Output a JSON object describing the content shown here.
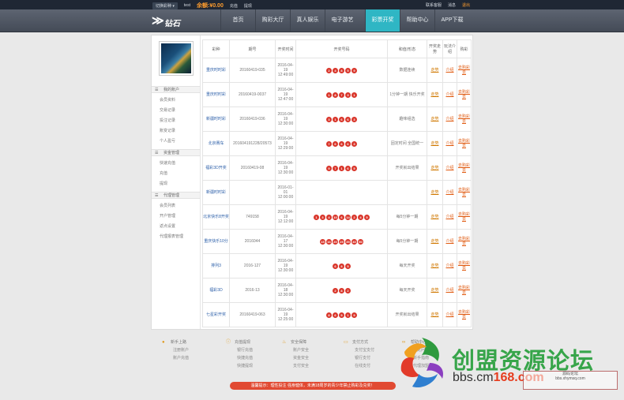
{
  "topbar": {
    "switch": "切换彩种",
    "user": "test",
    "balance_label": "余额:",
    "balance_value": "¥0.00",
    "deposit": "充值",
    "withdraw": "提现",
    "right_items": [
      "联系客服",
      "消息",
      "退出"
    ]
  },
  "logo": "钻石",
  "nav": [
    {
      "label": "首页"
    },
    {
      "label": "购彩大厅"
    },
    {
      "label": "真人娱乐"
    },
    {
      "label": "电子游艺"
    },
    {
      "label": "彩票开奖"
    },
    {
      "label": "帮助中心"
    },
    {
      "label": "APP下载"
    }
  ],
  "side": {
    "sections": [
      {
        "title": "我的账户",
        "items": [
          "会员资料",
          "交易记录",
          "投注记录",
          "账变记录",
          "个人盈亏"
        ]
      },
      {
        "title": "资金管理",
        "items": [
          "快速充值",
          "充值",
          "提现"
        ]
      },
      {
        "title": "代理管理",
        "items": [
          "会员列表",
          "开户管理",
          "返点设置",
          "代理报表管理"
        ]
      }
    ]
  },
  "table": {
    "headers": [
      "彩种",
      "期号",
      "开奖时间",
      "开奖号码",
      "和值/形态",
      "开奖走势",
      "玩法介绍",
      "购彩"
    ],
    "rows": [
      {
        "name": "重庆时时彩",
        "issue": "20160419-035",
        "time": "2016-04-19 12:49:00",
        "balls": [
          "2",
          "4",
          "8",
          "5",
          "9"
        ],
        "extra": "数据连续",
        "k": "走势",
        "c": "介绍",
        "b": "去购彩去"
      },
      {
        "name": "重庆时时彩",
        "issue": "20160419-0037",
        "time": "2016-04-19 12:47:00",
        "balls": [
          "1",
          "8",
          "7",
          "3",
          "1"
        ],
        "extra": "1分钟一期 快乐开奖",
        "k": "走势",
        "c": "介绍",
        "b": "去购彩去"
      },
      {
        "name": "新疆时时彩",
        "issue": "20160419-036",
        "time": "2016-04-19 12:30:00",
        "balls": [
          "3",
          "1",
          "6",
          "6",
          "3"
        ],
        "extra": "趣味组选",
        "k": "走势",
        "c": "介绍",
        "b": "去购彩去"
      },
      {
        "name": "北京赛车",
        "issue": "201604191228/20573",
        "time": "2016-04-19 12:29:00",
        "balls": [
          "7",
          "6",
          "6",
          "6",
          "3"
        ],
        "extra": "固定时间 全国统一",
        "k": "走势",
        "c": "介绍",
        "b": "去购彩去"
      },
      {
        "name": "福彩3D开奖",
        "issue": "20160419-08",
        "time": "2016-04-19 12:30:00",
        "balls": [
          "9",
          "7",
          "1",
          "6",
          "5"
        ],
        "extra": "开奖就出结果",
        "k": "走势",
        "c": "介绍",
        "b": "去购彩去"
      },
      {
        "name": "新疆时时彩",
        "issue": "",
        "time": "2016-01-01 12:00:00",
        "balls": [],
        "extra": "",
        "k": "走势",
        "c": "介绍",
        "b": "去购彩去"
      },
      {
        "name": "北京快乐8开奖",
        "issue": "749158",
        "time": "2016-04-19 12:12:00",
        "balls": [
          "1",
          "3",
          "4",
          "10",
          "6",
          "14",
          "2",
          "4",
          "5"
        ],
        "extra": "每5分钟一期",
        "k": "走势",
        "c": "介绍",
        "b": "去购彩去"
      },
      {
        "name": "重庆快乐10分",
        "issue": "2016044",
        "time": "2016-04-17 12:30:00",
        "balls": [
          "15",
          "16",
          "20",
          "25",
          "35",
          "40",
          "50"
        ],
        "extra": "每5分钟一期",
        "k": "走势",
        "c": "介绍",
        "b": "去购彩去"
      },
      {
        "name": "排列3",
        "issue": "2016-127",
        "time": "2016-04-19 12:30:00",
        "balls": [
          "6",
          "8",
          "5"
        ],
        "extra": "每天开奖",
        "k": "走势",
        "c": "介绍",
        "b": "去购彩去"
      },
      {
        "name": "福彩3D",
        "issue": "2016-13",
        "time": "2016-04-18 12:30:00",
        "balls": [
          "2",
          "8",
          "2"
        ],
        "extra": "每天开奖",
        "k": "走势",
        "c": "介绍",
        "b": "去购彩去"
      },
      {
        "name": "七星彩开奖",
        "issue": "20160419-063",
        "time": "2016-04-19 12:25:00",
        "balls": [
          "8",
          "6",
          "5",
          "1",
          "9"
        ],
        "extra": "开奖就出结果",
        "k": "走势",
        "c": "介绍",
        "b": "去购彩去"
      }
    ]
  },
  "footer": [
    {
      "title": "新手上路",
      "icon": "user-icon",
      "links": [
        "注册账户",
        "账户充值"
      ]
    },
    {
      "title": "充值提现",
      "icon": "info-icon",
      "links": [
        "银行充值",
        "快捷充值",
        "快捷提现"
      ]
    },
    {
      "title": "安全保障",
      "icon": "fire-icon",
      "links": [
        "账户安全",
        "资金安全",
        "支付安全"
      ]
    },
    {
      "title": "支付方式",
      "icon": "card-icon",
      "links": [
        "支付宝支付",
        "银行支付",
        "在线支付"
      ]
    },
    {
      "title": "帮助中心",
      "icon": "link-icon",
      "links": [
        "常见问题",
        "新手指南",
        "代理加盟"
      ]
    }
  ],
  "redbar": "温馨提示：理性投注 强身健体，未满18周岁的青少年禁止购彩及兑奖！",
  "watermark": {
    "title": "创盟资源论坛",
    "url_a": "bbs.cm",
    "url_b": "168.com",
    "stamp": "源码论坛",
    "stamp_sub": "bbs.xhymsq.com"
  }
}
